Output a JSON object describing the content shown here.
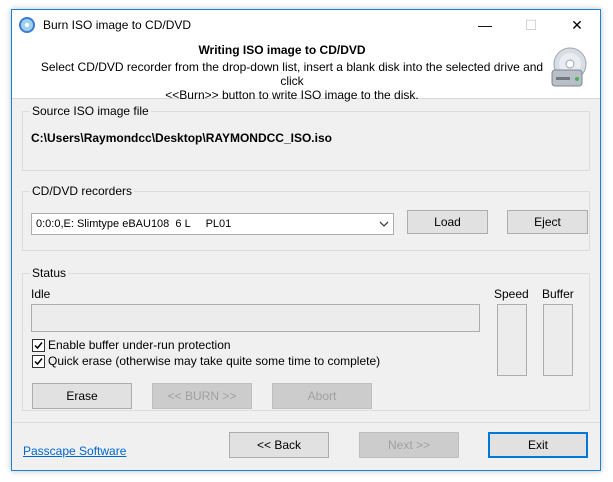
{
  "window": {
    "title": "Burn ISO image to CD/DVD",
    "minimize_glyph": "—",
    "maximize_glyph": "☐",
    "close_glyph": "✕"
  },
  "header": {
    "title": "Writing ISO image to CD/DVD",
    "description_line1": "Select CD/DVD recorder from the drop-down list, insert a blank disk into the selected drive and click",
    "description_line2": "<<Burn>> button to write ISO image to the disk."
  },
  "source": {
    "group_label": "Source ISO image file",
    "path": "C:\\Users\\Raymondcc\\Desktop\\RAYMONDCC_ISO.iso"
  },
  "recorders": {
    "group_label": "CD/DVD recorders",
    "selected": "0:0:0,E: Slimtype eBAU108  6 L     PL01",
    "load_label": "Load",
    "eject_label": "Eject"
  },
  "status": {
    "group_label": "Status",
    "state_text": "Idle",
    "speed_label": "Speed",
    "buffer_label": "Buffer",
    "option_buffer_label": "Enable buffer under-run protection",
    "option_buffer_checked": true,
    "option_quick_label": "Quick erase (otherwise may take quite some time to complete)",
    "option_quick_checked": true,
    "erase_label": "Erase",
    "burn_label": "<< BURN >>",
    "abort_label": "Abort"
  },
  "footer": {
    "link_label": "Passcape Software",
    "back_label": "<< Back",
    "next_label": "Next >>",
    "exit_label": "Exit"
  },
  "colors": {
    "accent": "#0078d7",
    "link": "#0066cc",
    "window_border": "#1883d7"
  },
  "icons": [
    "app-disc-icon",
    "disc-drive-icon",
    "dropdown-arrow-icon",
    "checkmark-icon"
  ]
}
